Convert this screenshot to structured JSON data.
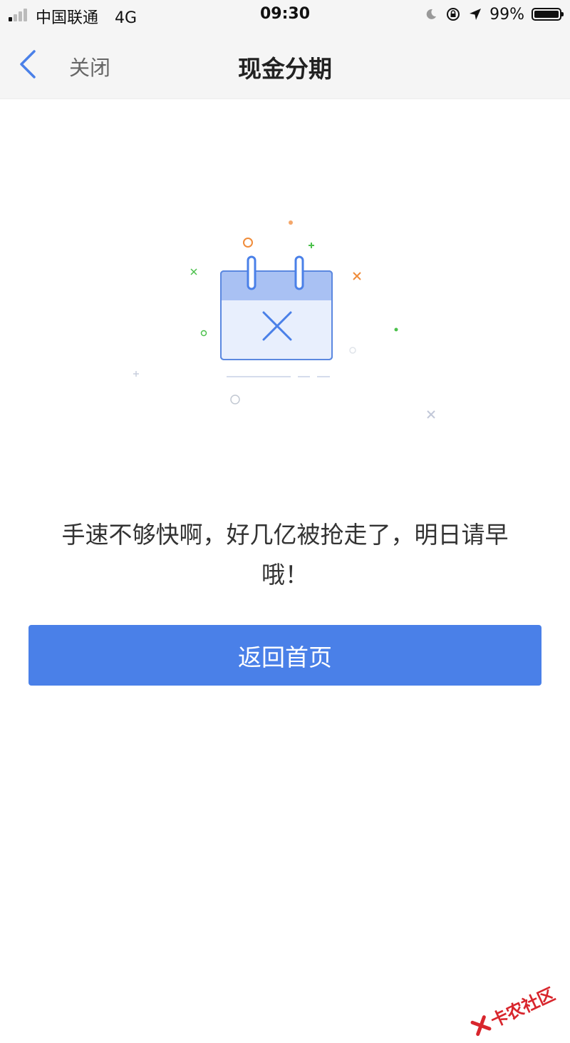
{
  "status_bar": {
    "carrier": "中国联通",
    "network": "4G",
    "time": "09:30",
    "battery": "99%",
    "battery_level": 0.99
  },
  "nav": {
    "back_icon": "chevron-left-icon",
    "close_label": "关闭",
    "title": "现金分期"
  },
  "illustration": {
    "icon": "calendar-x-icon"
  },
  "message": {
    "line1": "手速不够快啊，好几亿被抢走了，明日请早",
    "line2": "哦！"
  },
  "actions": {
    "home_button_label": "返回首页"
  },
  "watermark": {
    "text": "卡农社区"
  },
  "colors": {
    "accent": "#4a80e8",
    "nav_background": "#f5f5f5",
    "calendar_header": "#a9c1f3",
    "calendar_body": "#e8effd",
    "watermark": "#d8262d"
  }
}
